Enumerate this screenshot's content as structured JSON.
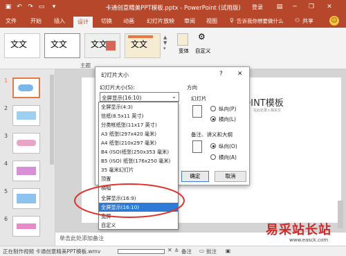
{
  "window": {
    "title": "卡通创意精美PPT模板.pptx - PowerPoint (试用版)",
    "login": "登录"
  },
  "ribbon": {
    "tabs": [
      {
        "label": "文件"
      },
      {
        "label": "开始"
      },
      {
        "label": "插入"
      },
      {
        "label": "设计"
      },
      {
        "label": "切换"
      },
      {
        "label": "动画"
      },
      {
        "label": "幻灯片放映"
      },
      {
        "label": "审阅"
      },
      {
        "label": "视图"
      }
    ],
    "tell_me": "告诉我你想要做什么",
    "share": "共享",
    "theme_text": "文文",
    "theme_group_label": "主题",
    "variants_label": "变体",
    "custom_label": "自定义"
  },
  "slide_pane": {
    "numbers": [
      "1",
      "2",
      "3",
      "4",
      "5",
      "6"
    ]
  },
  "slide": {
    "title_partial": "OINT模板",
    "subtitle_partial": "在此处录入相关文"
  },
  "notes": {
    "placeholder": "单击此处添加备注"
  },
  "status": {
    "left": "正在制作视频  卡通创意精美PPT模板.wmv",
    "notes_btn": "备注",
    "comments_btn": "批注"
  },
  "dialog": {
    "title": "幻灯片大小",
    "help": "?",
    "close": "✕",
    "size_label": "幻灯片大小(S):",
    "size_value": "全屏显示(16:10)",
    "orientation_label": "方向",
    "slides_label": "幻灯片",
    "portrait": "纵向(P)",
    "landscape": "横向(L)",
    "notes_label": "备注、讲义和大纲",
    "notes_portrait": "纵向(O)",
    "notes_landscape": "横向(A)",
    "ok": "确定",
    "cancel": "取消"
  },
  "dropdown": {
    "options": [
      "全屏显示(4:3)",
      "信纸(8.5x11 英寸)",
      "分类帐纸张(11x17 英寸)",
      "A3 纸张(297x420 毫米)",
      "A4 纸张(210x297 毫米)",
      "B4 (ISO)纸张(250x353 毫米)",
      "B5 (ISO) 纸张(176x250 毫米)",
      "35 毫米幻灯片",
      "顶置",
      "横幅",
      "全屏显示(16:9)",
      "全屏显示(16:10)",
      "宽屏",
      "自定义"
    ],
    "selected_index": 11
  },
  "watermark": {
    "text": "易采站长站",
    "url": "www.easck.com"
  },
  "colors": {
    "brand": "#b7472a",
    "highlight": "#2d7bd6",
    "annotation": "#e0312c"
  }
}
